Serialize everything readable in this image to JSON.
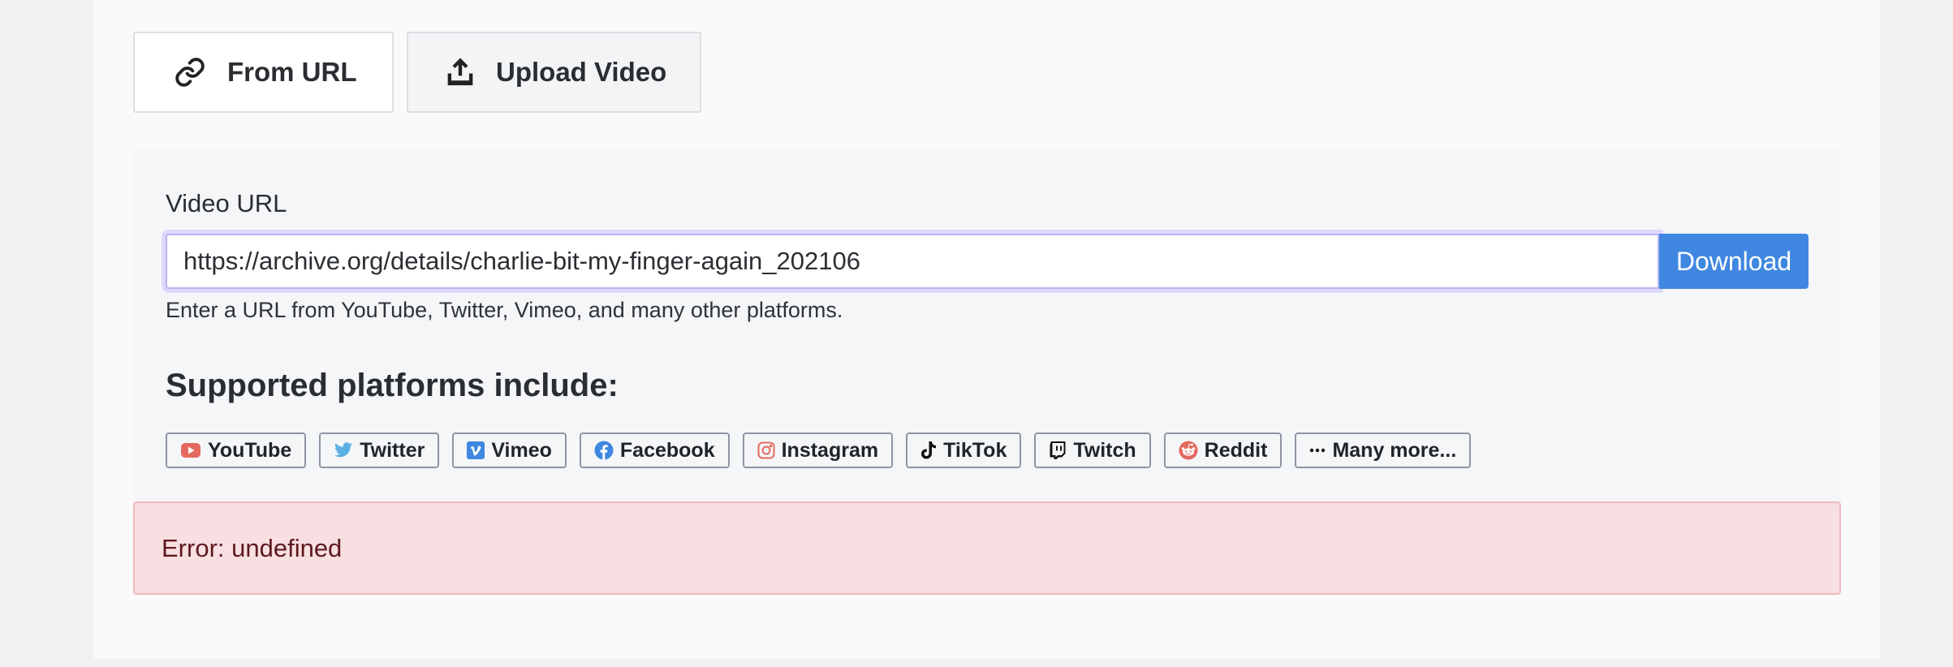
{
  "tabs": [
    {
      "label": "From URL",
      "icon": "link-icon",
      "active": true
    },
    {
      "label": "Upload Video",
      "icon": "upload-icon",
      "active": false
    }
  ],
  "form": {
    "label": "Video URL",
    "url_value": "https://archive.org/details/charlie-bit-my-finger-again_202106",
    "download_label": "Download",
    "help_text": "Enter a URL from YouTube, Twitter, Vimeo, and many other platforms."
  },
  "platforms": {
    "heading": "Supported platforms include:",
    "items": [
      {
        "label": "YouTube",
        "icon": "youtube-icon",
        "color": "#e5695f"
      },
      {
        "label": "Twitter",
        "icon": "twitter-icon",
        "color": "#5ab0e1"
      },
      {
        "label": "Vimeo",
        "icon": "vimeo-icon",
        "color": "#3f87e0"
      },
      {
        "label": "Facebook",
        "icon": "facebook-icon",
        "color": "#3f87e0"
      },
      {
        "label": "Instagram",
        "icon": "instagram-icon",
        "color": "#e5695f"
      },
      {
        "label": "TikTok",
        "icon": "tiktok-icon",
        "color": "#111111"
      },
      {
        "label": "Twitch",
        "icon": "twitch-icon",
        "color": "#111111"
      },
      {
        "label": "Reddit",
        "icon": "reddit-icon",
        "color": "#e5695f"
      },
      {
        "label": "Many more...",
        "icon": "ellipsis-icon",
        "color": "#111111"
      }
    ]
  },
  "error": {
    "message": "Error: undefined"
  },
  "colors": {
    "accent": "#3f87e0",
    "error_background": "#f8dfe1",
    "error_text": "#5e1a1f",
    "focus_ring": "#dcd8fb"
  }
}
